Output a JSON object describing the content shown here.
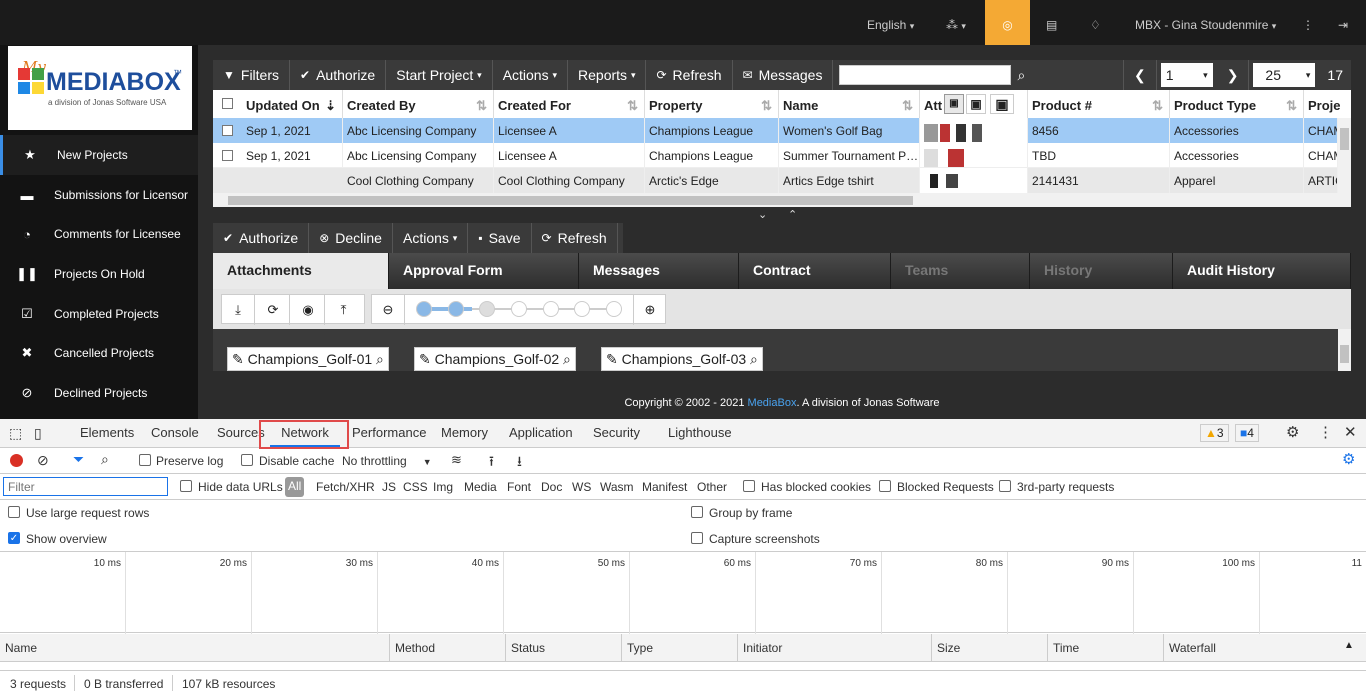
{
  "topbar": {
    "language": "English",
    "user": "MBX - Gina Stoudenmire",
    "colors": {
      "accent": "#f4a934"
    }
  },
  "logo": {
    "my": "My",
    "main": "MEDIABOX",
    "tm": "™",
    "tagline": "a division of Jonas Software USA"
  },
  "sidebar": {
    "items": [
      {
        "label": "New Projects",
        "icon": "star-icon"
      },
      {
        "label": "Submissions for Licensor",
        "icon": "folder-icon"
      },
      {
        "label": "Comments for Licensee",
        "icon": "comments-icon"
      },
      {
        "label": "Projects On Hold",
        "icon": "pause-icon"
      },
      {
        "label": "Completed Projects",
        "icon": "check-square-icon"
      },
      {
        "label": "Cancelled Projects",
        "icon": "x-icon"
      },
      {
        "label": "Declined Projects",
        "icon": "ban-icon"
      }
    ]
  },
  "toolbar": {
    "filters": "Filters",
    "authorize": "Authorize",
    "start_project": "Start Project",
    "actions": "Actions",
    "reports": "Reports",
    "refresh": "Refresh",
    "messages": "Messages",
    "search_value": "",
    "page": "1",
    "page_size": "25",
    "total": "17"
  },
  "grid": {
    "columns": [
      "Updated On",
      "Created By",
      "Created For",
      "Property",
      "Name",
      "Att",
      "Product #",
      "Product Type",
      "Proje"
    ],
    "rows": [
      [
        "Sep 1, 2021",
        "Abc Licensing Company",
        "Licensee A",
        "Champions League",
        "Women's Golf Bag",
        "",
        "8456",
        "Accessories",
        "CHAM"
      ],
      [
        "Sep 1, 2021",
        "Abc Licensing Company",
        "Licensee A",
        "Champions League",
        "Summer Tournament P…",
        "",
        "TBD",
        "Accessories",
        "CHAM"
      ],
      [
        "",
        "Cool Clothing Company",
        "Cool Clothing Company",
        "Arctic's Edge",
        "Artics Edge tshirt",
        "",
        "2141431",
        "Apparel",
        "ARTIC"
      ]
    ]
  },
  "bottom_toolbar": {
    "authorize": "Authorize",
    "decline": "Decline",
    "actions": "Actions",
    "save": "Save",
    "refresh": "Refresh"
  },
  "tabs": [
    "Attachments",
    "Approval Form",
    "Messages",
    "Contract",
    "Teams",
    "History",
    "Audit History"
  ],
  "attachments": {
    "zoom_level": 0.25,
    "files": [
      "Champions_Golf-01",
      "Champions_Golf-02",
      "Champions_Golf-03"
    ]
  },
  "footer": {
    "prefix": "Copyright © 2002 - 2021 ",
    "brand": "MediaBox",
    "suffix": ". A division of Jonas Software"
  },
  "devtools": {
    "tabs": [
      "Elements",
      "Console",
      "Sources",
      "Network",
      "Performance",
      "Memory",
      "Application",
      "Security",
      "Lighthouse"
    ],
    "active_tab": "Network",
    "warnings": "3",
    "messages": "4",
    "preserve_log": "Preserve log",
    "disable_cache": "Disable cache",
    "throttling": "No throttling",
    "filter_placeholder": "Filter",
    "hide_data_urls": "Hide data URLs",
    "type_filters": [
      "All",
      "Fetch/XHR",
      "JS",
      "CSS",
      "Img",
      "Media",
      "Font",
      "Doc",
      "WS",
      "Wasm",
      "Manifest",
      "Other"
    ],
    "has_blocked_cookies": "Has blocked cookies",
    "blocked_requests": "Blocked Requests",
    "third_party": "3rd-party requests",
    "large_rows": "Use large request rows",
    "show_overview": "Show overview",
    "group_by_frame": "Group by frame",
    "capture_screenshots": "Capture screenshots",
    "timeline_ticks": [
      "10 ms",
      "20 ms",
      "30 ms",
      "40 ms",
      "50 ms",
      "60 ms",
      "70 ms",
      "80 ms",
      "90 ms",
      "100 ms",
      "11"
    ],
    "table_columns": [
      "Name",
      "Method",
      "Status",
      "Type",
      "Initiator",
      "Size",
      "Time",
      "Waterfall"
    ],
    "status": {
      "requests": "3 requests",
      "transferred": "0 B transferred",
      "resources": "107 kB resources"
    }
  }
}
